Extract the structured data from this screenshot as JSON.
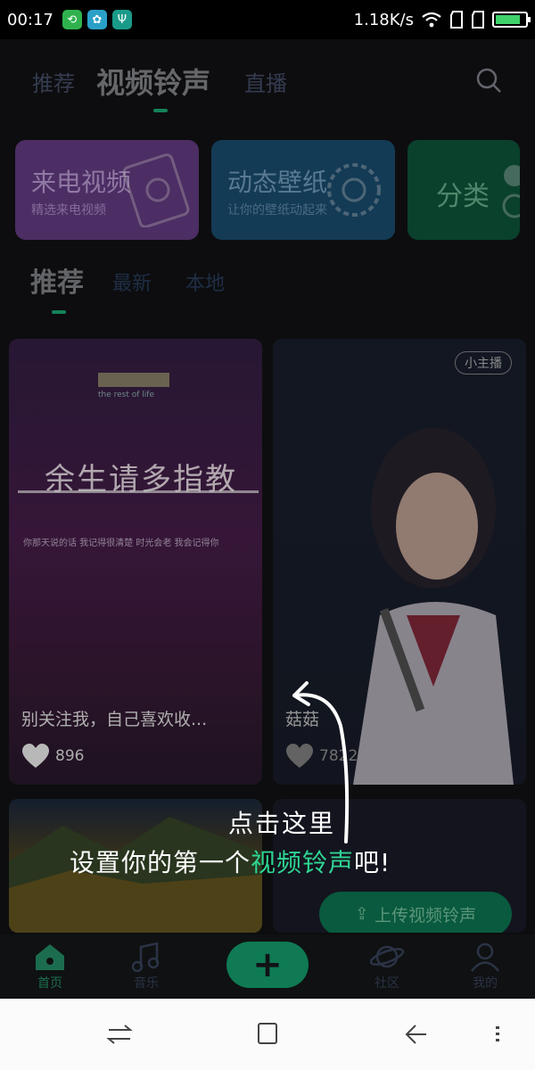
{
  "status_bar": {
    "time": "00:17",
    "speed": "1.18K/s",
    "battery_level": 0.85
  },
  "top_nav": {
    "tabs": [
      "推荐",
      "视频铃声",
      "直播"
    ],
    "active": "视频铃声"
  },
  "categories": [
    {
      "title": "来电视频",
      "subtitle": "精选来电视频"
    },
    {
      "title": "动态壁纸",
      "subtitle": "让你的壁纸动起来"
    },
    {
      "title": "分类"
    }
  ],
  "sub_tabs": {
    "tabs": [
      "推荐",
      "最新",
      "本地"
    ],
    "active": "推荐"
  },
  "feed": {
    "card1": {
      "poster_title": "余生请多指教",
      "poster_caption": "the rest of life",
      "poster_body": "你那天说的话 我记得很清楚 时光会老 我会记得你",
      "title": "别关注我，自己喜欢收...",
      "likes": "896"
    },
    "card2": {
      "badge": "小主播",
      "title": "菇菇",
      "likes": "7822"
    },
    "card4": {
      "upload_label": "上传视频铃声"
    }
  },
  "guide": {
    "line1": "点击这里",
    "line2_prefix": "设置你的第一个",
    "line2_highlight": "视频铃声",
    "line2_suffix": "吧!"
  },
  "bottom_nav": {
    "items": [
      "首页",
      "音乐",
      "社区",
      "我的"
    ],
    "active": "首页",
    "plus": "+"
  },
  "colors": {
    "accent": "#1db47b",
    "highlight": "#2fd593",
    "incall_card": "#6a3f8b",
    "wallpaper_card": "#1c5277",
    "category_card": "#0e5b3e"
  }
}
